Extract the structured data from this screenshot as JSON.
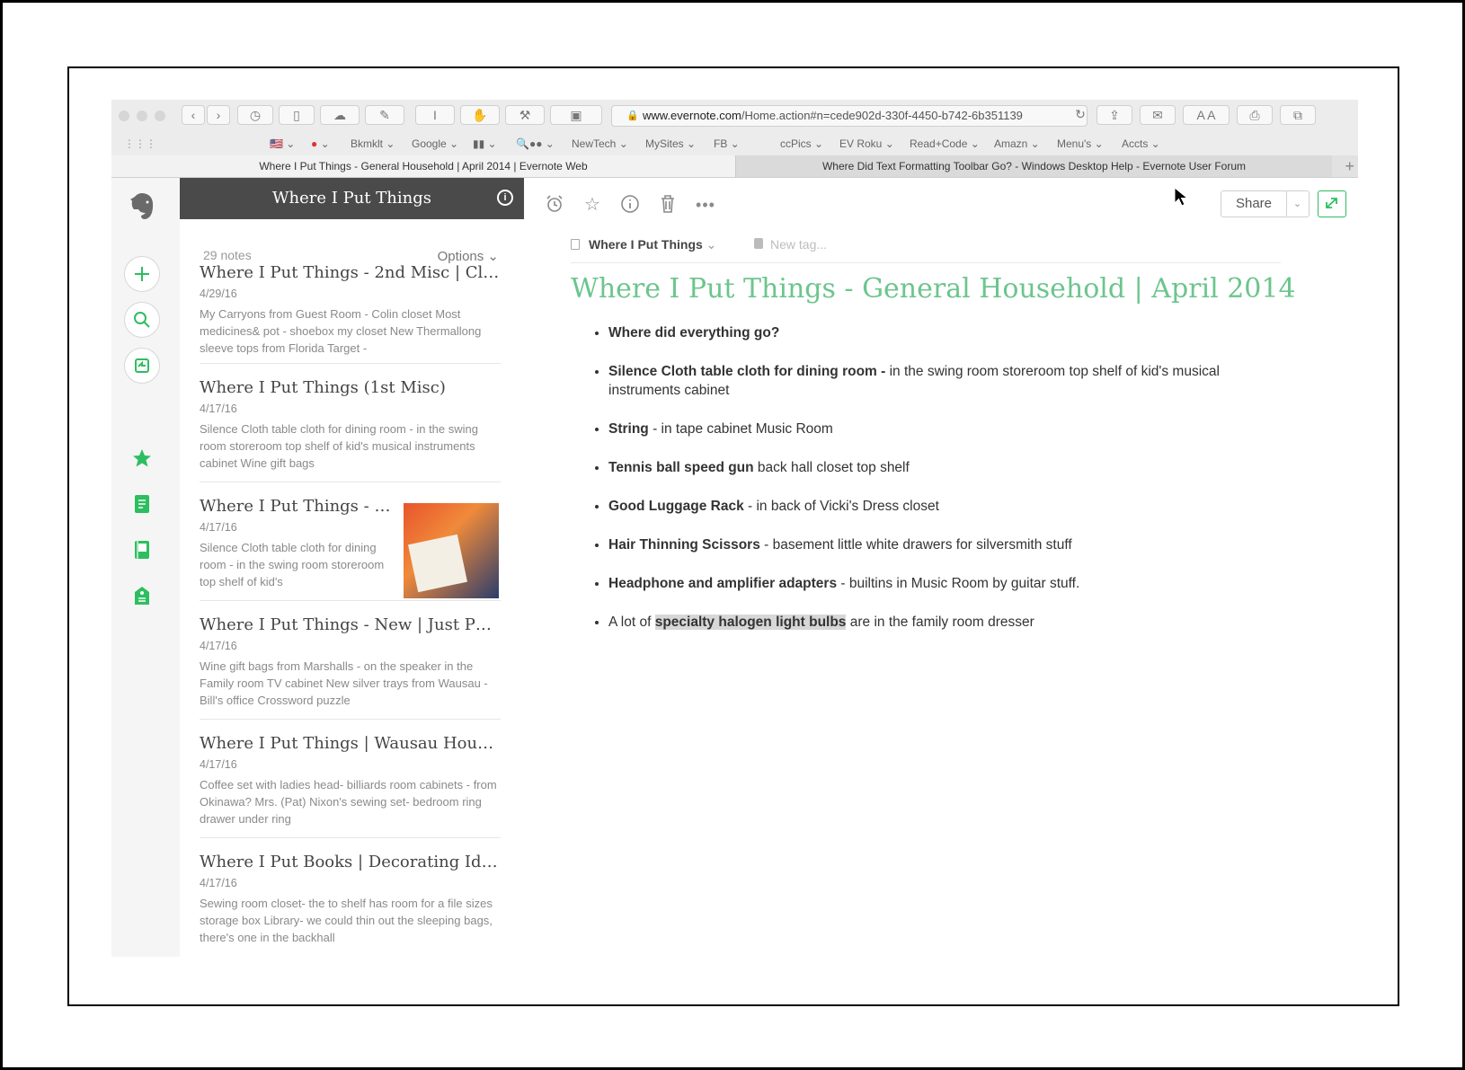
{
  "browser": {
    "url_domain": "www.evernote.com",
    "url_path": "/Home.action#n=cede902d-330f-4450-b742-6b351139",
    "bookmarks": [
      "Bkmklt ⌄",
      "Google ⌄",
      "NewTech ⌄",
      "MySites ⌄",
      "FB ⌄",
      "ccPics ⌄",
      "EV Roku ⌄",
      "Read+Code ⌄",
      "Amazn ⌄",
      "Menu's ⌄",
      "Accts ⌄"
    ],
    "tabs": [
      {
        "label": "Where I Put Things - General Household | April 2014 | Evernote Web"
      },
      {
        "label": "Where Did Text Formatting Toolbar Go? - Windows Desktop Help - Evernote User Forum"
      }
    ]
  },
  "notebook_panel": {
    "title": "Where I Put Things",
    "count": "29 notes",
    "options_label": "Options ⌄"
  },
  "notes": [
    {
      "title": "Where I Put Things - 2nd Misc | Clot…",
      "date": "4/29/16",
      "snippet": "My Carryons from Guest Room - Colin closet Most medicines& pot - shoebox my closet New Thermallong sleeve tops from Florida Target -"
    },
    {
      "title": "Where I Put Things (1st Misc)",
      "date": "4/17/16",
      "snippet": "Silence Cloth table cloth for dining room - in the swing room storeroom top shelf of kid's musical instruments cabinet  Wine gift bags"
    },
    {
      "title": "Where I Put Things - Ki…",
      "date": "4/17/16",
      "snippet": "Silence Cloth table cloth for dining room - in the swing room storeroom top shelf of kid's"
    },
    {
      "title": "Where I Put Things - New | Just Purc…",
      "date": "4/17/16",
      "snippet": "Wine gift bags from Marshalls - on the speaker in the Family room TV cabinet New silver trays from Wausau - Bill's office Crossword puzzle"
    },
    {
      "title": "Where I Put Things | Wausau House …",
      "date": "4/17/16",
      "snippet": "Coffee set with ladies head- billiards room cabinets - from Okinawa? Mrs. (Pat) Nixon's sewing set- bedroom ring drawer under ring"
    },
    {
      "title": "Where I Put Books | Decorating Idea…",
      "date": "4/17/16",
      "snippet": "Sewing room closet- the to shelf has room for a file sizes storage box Library- we could thin out the sleeping bags, there's one in the backhall"
    }
  ],
  "editor": {
    "share_label": "Share",
    "notebook_name": "Where I Put Things",
    "tag_placeholder": "New tag...",
    "heading": "Where I Put Things - General Household | April 2014",
    "items": [
      {
        "bold": "Where did everything go?",
        "rest": ""
      },
      {
        "bold": "Silence Cloth table cloth for dining room - ",
        "rest": "in the swing room storeroom top shelf of kid's musical instruments cabinet"
      },
      {
        "bold": "String",
        "rest": " - in tape cabinet Music Room"
      },
      {
        "bold": "Tennis ball speed gun",
        "rest": " back hall closet top shelf"
      },
      {
        "bold": "Good Luggage Rack",
        "rest": " - in back of Vicki's Dress closet"
      },
      {
        "bold": "Hair Thinning Scissors",
        "rest": " - basement little white drawers for silversmith stuff"
      },
      {
        "bold": "Headphone and amplifier adapters",
        "rest": " - builtins in Music Room by guitar stuff."
      }
    ],
    "last_item": {
      "pre": "A lot of ",
      "highlight": "specialty halogen light bulbs",
      "post": " are in the family room dresser"
    }
  },
  "colors": {
    "accent": "#2dbe60",
    "heading": "#6cc58d",
    "header_bg": "#4a4a4a"
  }
}
